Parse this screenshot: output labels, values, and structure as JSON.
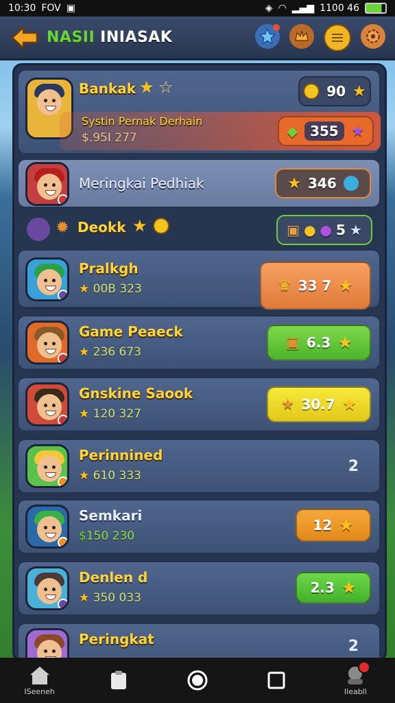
{
  "status": {
    "time": "10:30",
    "carrier": "FOV",
    "battery_text": "1100 46"
  },
  "header": {
    "title_part1": "NASII",
    "title_part2": "INIASAK"
  },
  "colors": {
    "accent_green": "#6bd23a",
    "gold": "#ffd43a",
    "panel": "#263651"
  },
  "rows": [
    {
      "name": "Bankak",
      "sub_title": "Systin Pernak Derhain",
      "sub_values": "$.95I 277",
      "score": "90"
    },
    {
      "name": "Meringkai Pedhiak",
      "score": "346"
    },
    {
      "name": "Deokk",
      "score": "5"
    },
    {
      "name": "Pralkgh",
      "sub_values": "00B 323",
      "score": "33 7"
    },
    {
      "name": "Game Peaeck",
      "sub_values": "236 673",
      "score": "6.3"
    },
    {
      "name": "Gnskine Saook",
      "sub_values": "120 327",
      "score": "30.7"
    },
    {
      "name": "Perinnined",
      "sub_values": "610 333",
      "score": "2"
    },
    {
      "name": "Semkari",
      "sub_values": "150 230",
      "score": "12"
    },
    {
      "name": "Denlen d",
      "sub_values": "350 033",
      "score": "2.3"
    },
    {
      "name": "Peringkat",
      "sub_values": "",
      "score": "2"
    }
  ],
  "nav": {
    "home_label": "ISeeneh",
    "profile_label": "Ileabll"
  }
}
